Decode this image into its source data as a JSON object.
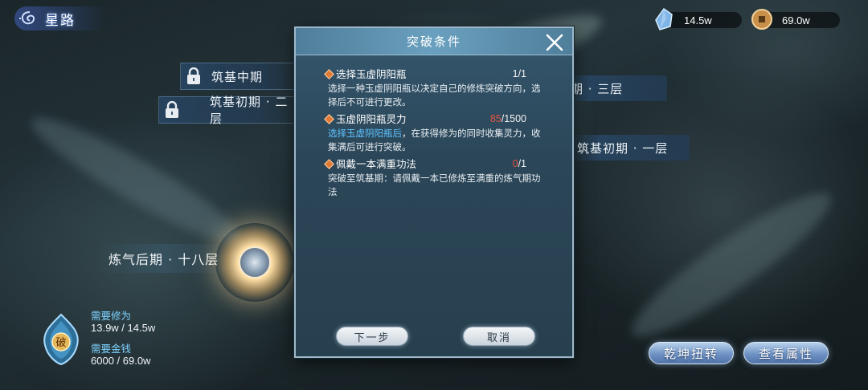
{
  "header": {
    "title": "星路"
  },
  "currency": {
    "cultivation": {
      "icon": "crystal-icon",
      "value": "14.5w"
    },
    "money": {
      "icon": "coin-icon",
      "value": "69.0w"
    }
  },
  "realms_left": [
    {
      "label": "筑基中期"
    },
    {
      "label": "筑基初期 · 二层"
    }
  ],
  "realms_right": [
    {
      "label": "期 · 三层"
    },
    {
      "label": "筑基初期 · 一层"
    }
  ],
  "current_realm": {
    "label": "炼气后期 · 十八层"
  },
  "requirements": {
    "emblem_char": "破",
    "cultivation_label": "需要修为",
    "cultivation_value": "13.9w / 14.5w",
    "money_label": "需要金钱",
    "money_value": "6000 / 69.0w"
  },
  "modal": {
    "title": "突破条件",
    "conditions": [
      {
        "name": "选择玉虚阴阳瓶",
        "progress_current": "1",
        "progress_total": "/1",
        "desc_highlight": "",
        "desc": "选择一种玉虚阴阳瓶以决定自己的修炼突破方向，选择后不可进行更改。"
      },
      {
        "name": "玉虚阴阳瓶灵力",
        "progress_current": "85",
        "progress_total": "/1500",
        "desc_highlight": "选择玉虚阴阳瓶后",
        "desc": "，在获得修为的同时收集灵力，收集满后可进行突破。"
      },
      {
        "name": "佩戴一本满重功法",
        "progress_current": "0",
        "progress_total": "/1",
        "desc_highlight": "",
        "desc": "突破至筑基期：请佩戴一本已修炼至满重的炼气期功法"
      }
    ],
    "next_button": "下一步",
    "cancel_button": "取消"
  },
  "actions": {
    "rotate_button": "乾坤扭转",
    "view_attributes_button": "查看属性"
  },
  "colors": {
    "highlight_text": "#5ec3ff",
    "insufficient_text": "#e2543f",
    "requirement_label": "#7fd2ff",
    "condition_marker": "#e07b35"
  }
}
